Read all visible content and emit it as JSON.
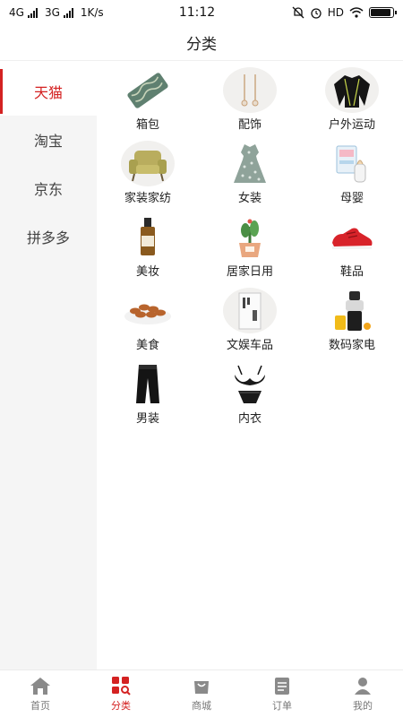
{
  "status_bar": {
    "net1": "4G",
    "net2": "3G",
    "speed": "1K/s",
    "time": "11:12",
    "hd": "HD",
    "battery_level": 0.85
  },
  "header": {
    "title": "分类"
  },
  "sidebar": {
    "items": [
      {
        "label": "天猫",
        "active": true
      },
      {
        "label": "淘宝",
        "active": false
      },
      {
        "label": "京东",
        "active": false
      },
      {
        "label": "拼多多",
        "active": false
      }
    ]
  },
  "categories": [
    {
      "label": "箱包",
      "icon": "bag-icon"
    },
    {
      "label": "配饰",
      "icon": "earrings-icon"
    },
    {
      "label": "户外运动",
      "icon": "sport-shirt-icon"
    },
    {
      "label": "家装家纺",
      "icon": "sofa-chair-icon"
    },
    {
      "label": "女装",
      "icon": "dress-icon"
    },
    {
      "label": "母婴",
      "icon": "baby-bottle-icon"
    },
    {
      "label": "美妆",
      "icon": "cosmetic-bottle-icon"
    },
    {
      "label": "居家日用",
      "icon": "plant-pot-icon"
    },
    {
      "label": "鞋品",
      "icon": "sneaker-icon"
    },
    {
      "label": "美食",
      "icon": "nuts-plate-icon"
    },
    {
      "label": "文娱车品",
      "icon": "book-icon"
    },
    {
      "label": "数码家电",
      "icon": "juicer-icon"
    },
    {
      "label": "男装",
      "icon": "pants-icon"
    },
    {
      "label": "内衣",
      "icon": "lingerie-icon"
    }
  ],
  "tabbar": {
    "items": [
      {
        "label": "首页",
        "icon": "home-icon",
        "active": false
      },
      {
        "label": "分类",
        "icon": "category-icon",
        "active": true
      },
      {
        "label": "商城",
        "icon": "shop-bag-icon",
        "active": false
      },
      {
        "label": "订单",
        "icon": "order-list-icon",
        "active": false
      },
      {
        "label": "我的",
        "icon": "user-icon",
        "active": false
      }
    ]
  },
  "colors": {
    "accent": "#d42222",
    "sidebar_bg": "#f5f5f5",
    "tab_inactive": "#999999"
  }
}
